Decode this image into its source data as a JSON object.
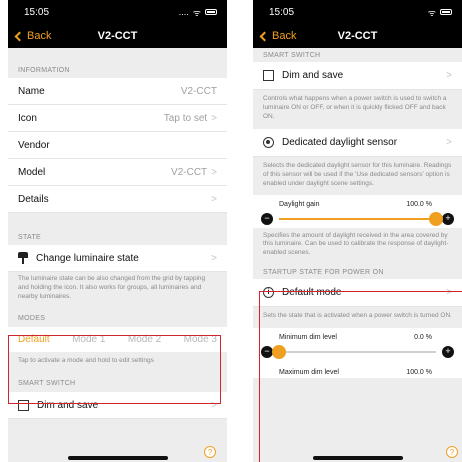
{
  "status": {
    "time": "15:05",
    "dots": "....",
    "wifi": "ᯤ"
  },
  "nav": {
    "back": "Back",
    "title": "V2-CCT"
  },
  "left": {
    "information_header": "INFORMATION",
    "rows": [
      {
        "label": "Name",
        "value": "V2-CCT",
        "arrow": ""
      },
      {
        "label": "Icon",
        "value": "Tap to set",
        "arrow": ">"
      },
      {
        "label": "Vendor",
        "value": "",
        "arrow": ""
      },
      {
        "label": "Model",
        "value": "V2-CCT",
        "arrow": ">"
      },
      {
        "label": "Details",
        "value": "",
        "arrow": ">"
      }
    ],
    "state_header": "STATE",
    "change_state": "Change luminaire state",
    "state_note": "The luminaire state can be also changed from the grid by tapping and holding the icon. It also works for groups, all luminaires and nearby luminaires.",
    "modes_header": "MODES",
    "modes": [
      "Default",
      "Mode 1",
      "Mode 2",
      "Mode 3"
    ],
    "modes_note": "Tap to activate a mode and hold to edit settings",
    "smart_switch_header": "SMART SWITCH",
    "dim_and_save": "Dim and save"
  },
  "right": {
    "smart_switch_header": "SMART SWITCH",
    "dim_and_save": "Dim and save",
    "dim_note": "Controls what happens when a power switch is used to switch a luminaire ON or OFF, or when it is quickly flicked OFF and back ON.",
    "daylight_sensor": "Dedicated daylight sensor",
    "daylight_note": "Selects the dedicated daylight sensor for this luminaire. Readings of this sensor will be used if the 'Use dedicated sensors' option is enabled under daylight scene settings.",
    "daylight_gain_label": "Daylight gain",
    "daylight_gain_value": "100.0 %",
    "daylight_gain": 1.0,
    "gain_note": "Specifies the amount of daylight received in the area covered by this luminaire. Can be used to calibrate the response of daylight-enabled scenes.",
    "startup_header": "STARTUP STATE FOR POWER ON",
    "default_mode": "Default mode",
    "startup_note": "Sets the state that is activated when a power switch is turned ON.",
    "min_dim_label": "Minimum dim level",
    "min_dim_value": "0.0 %",
    "min_dim": 0.0,
    "max_dim_label": "Maximum dim level",
    "max_dim_value": "100.0 %"
  },
  "symbols": {
    "minus": "−",
    "plus": "+",
    "help": "?",
    "info": "i",
    "arrow": ">"
  },
  "colors": {
    "accent": "#f0a020",
    "highlight": "#d3242b"
  }
}
